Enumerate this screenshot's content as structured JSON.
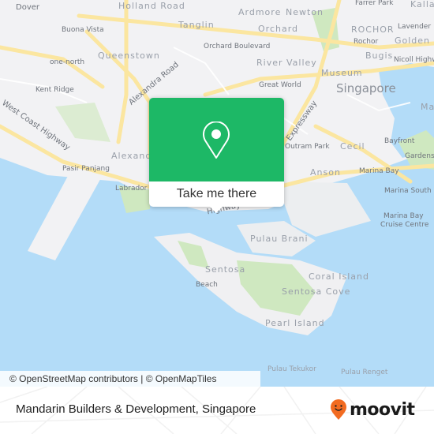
{
  "map": {
    "colors": {
      "land": "#f2f2f4",
      "water": "#b3dcf8",
      "park": "#cfe8c0",
      "road": "#fbe6a0"
    },
    "labels": {
      "dover": "Dover",
      "holland_road": "Holland Road",
      "ardmore": "Ardmore",
      "newton": "Newton",
      "farrer_park": "Farrer Park",
      "kallang": "Kalla",
      "buona_vista": "Buona Vista",
      "tanglin": "Tanglin",
      "orchard": "Orchard",
      "rochor_area": "ROCHOR",
      "lavender": "Lavender",
      "rochor": "Rochor",
      "golden_mile": "Golden M",
      "queenstown": "Queenstown",
      "orchard_boulevard": "Orchard Boulevard",
      "bugis": "Bugis",
      "nicoll_highway": "Nicoll Highw",
      "one_north": "one-north",
      "river_valley": "River Valley",
      "museum": "Museum",
      "kent_ridge": "Kent Ridge",
      "alexandra_road": "Alexandra Road",
      "great_world": "Great World",
      "singapore": "Singapore",
      "west_coast_highway": "West Coast Highway",
      "expressway": "Expressway",
      "outram_park": "Outram Park",
      "cecil": "Cecil",
      "bayfront": "Bayfront",
      "marina": "Mar",
      "alexandra": "Alexandr",
      "gardens": "Gardens",
      "pasir_panjang": "Pasir Panjang",
      "anson": "Anson",
      "marina_bay": "Marina Bay",
      "labrador": "Labrador P",
      "marina_south_pier": "Marina South Pi",
      "highway": "Highway",
      "pulau_brani": "Pulau Brani",
      "marina_bay_cruise": "Marina Bay",
      "cruise_centre": "Cruise Centre",
      "sentosa": "Sentosa",
      "coral_island": "Coral Island",
      "beach": "Beach",
      "sentosa_cove": "Sentosa Cove",
      "pearl_island": "Pearl Island",
      "pulau_tekukor": "Pulau Tekukor",
      "pulau_renget": "Pulau Renget"
    },
    "attribution": "© OpenStreetMap contributors | © OpenMapTiles"
  },
  "popup": {
    "icon": "map-pin-icon",
    "button_label": "Take me there",
    "color": "#1db866"
  },
  "footer": {
    "place_title": "Mandarin Builders & Development, Singapore",
    "logo_text": "moovit",
    "logo_color": "#f26b21"
  }
}
